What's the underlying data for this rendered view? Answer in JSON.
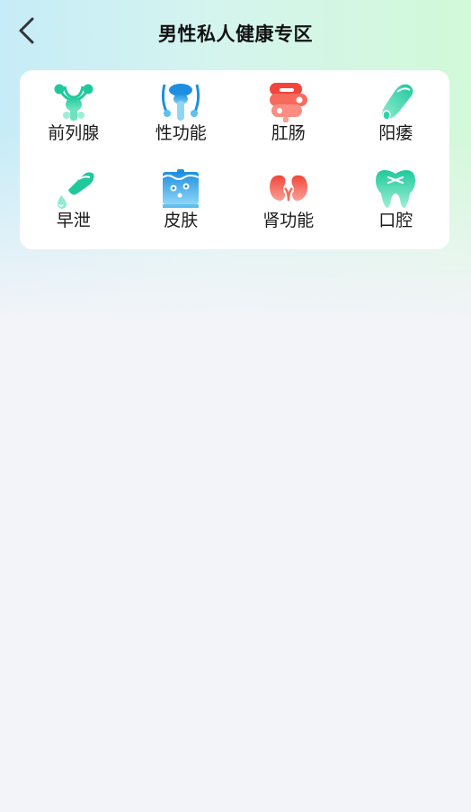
{
  "header": {
    "title": "男性私人健康专区"
  },
  "categories": [
    {
      "label": "前列腺",
      "icon": "prostate-icon",
      "color": "#2fd4a8"
    },
    {
      "label": "性功能",
      "icon": "reproductive-organ-icon",
      "color": "#3aa8e8"
    },
    {
      "label": "肛肠",
      "icon": "intestine-icon",
      "color": "#f5554a"
    },
    {
      "label": "阳痿",
      "icon": "penis-icon",
      "color": "#2fd4a8"
    },
    {
      "label": "早泄",
      "icon": "premature-ejaculation-icon",
      "color": "#2fd4a8"
    },
    {
      "label": "皮肤",
      "icon": "skin-icon",
      "color": "#3aa8e8"
    },
    {
      "label": "肾功能",
      "icon": "kidney-icon",
      "color": "#f5554a"
    },
    {
      "label": "口腔",
      "icon": "tooth-icon",
      "color": "#2fd4a8"
    }
  ]
}
